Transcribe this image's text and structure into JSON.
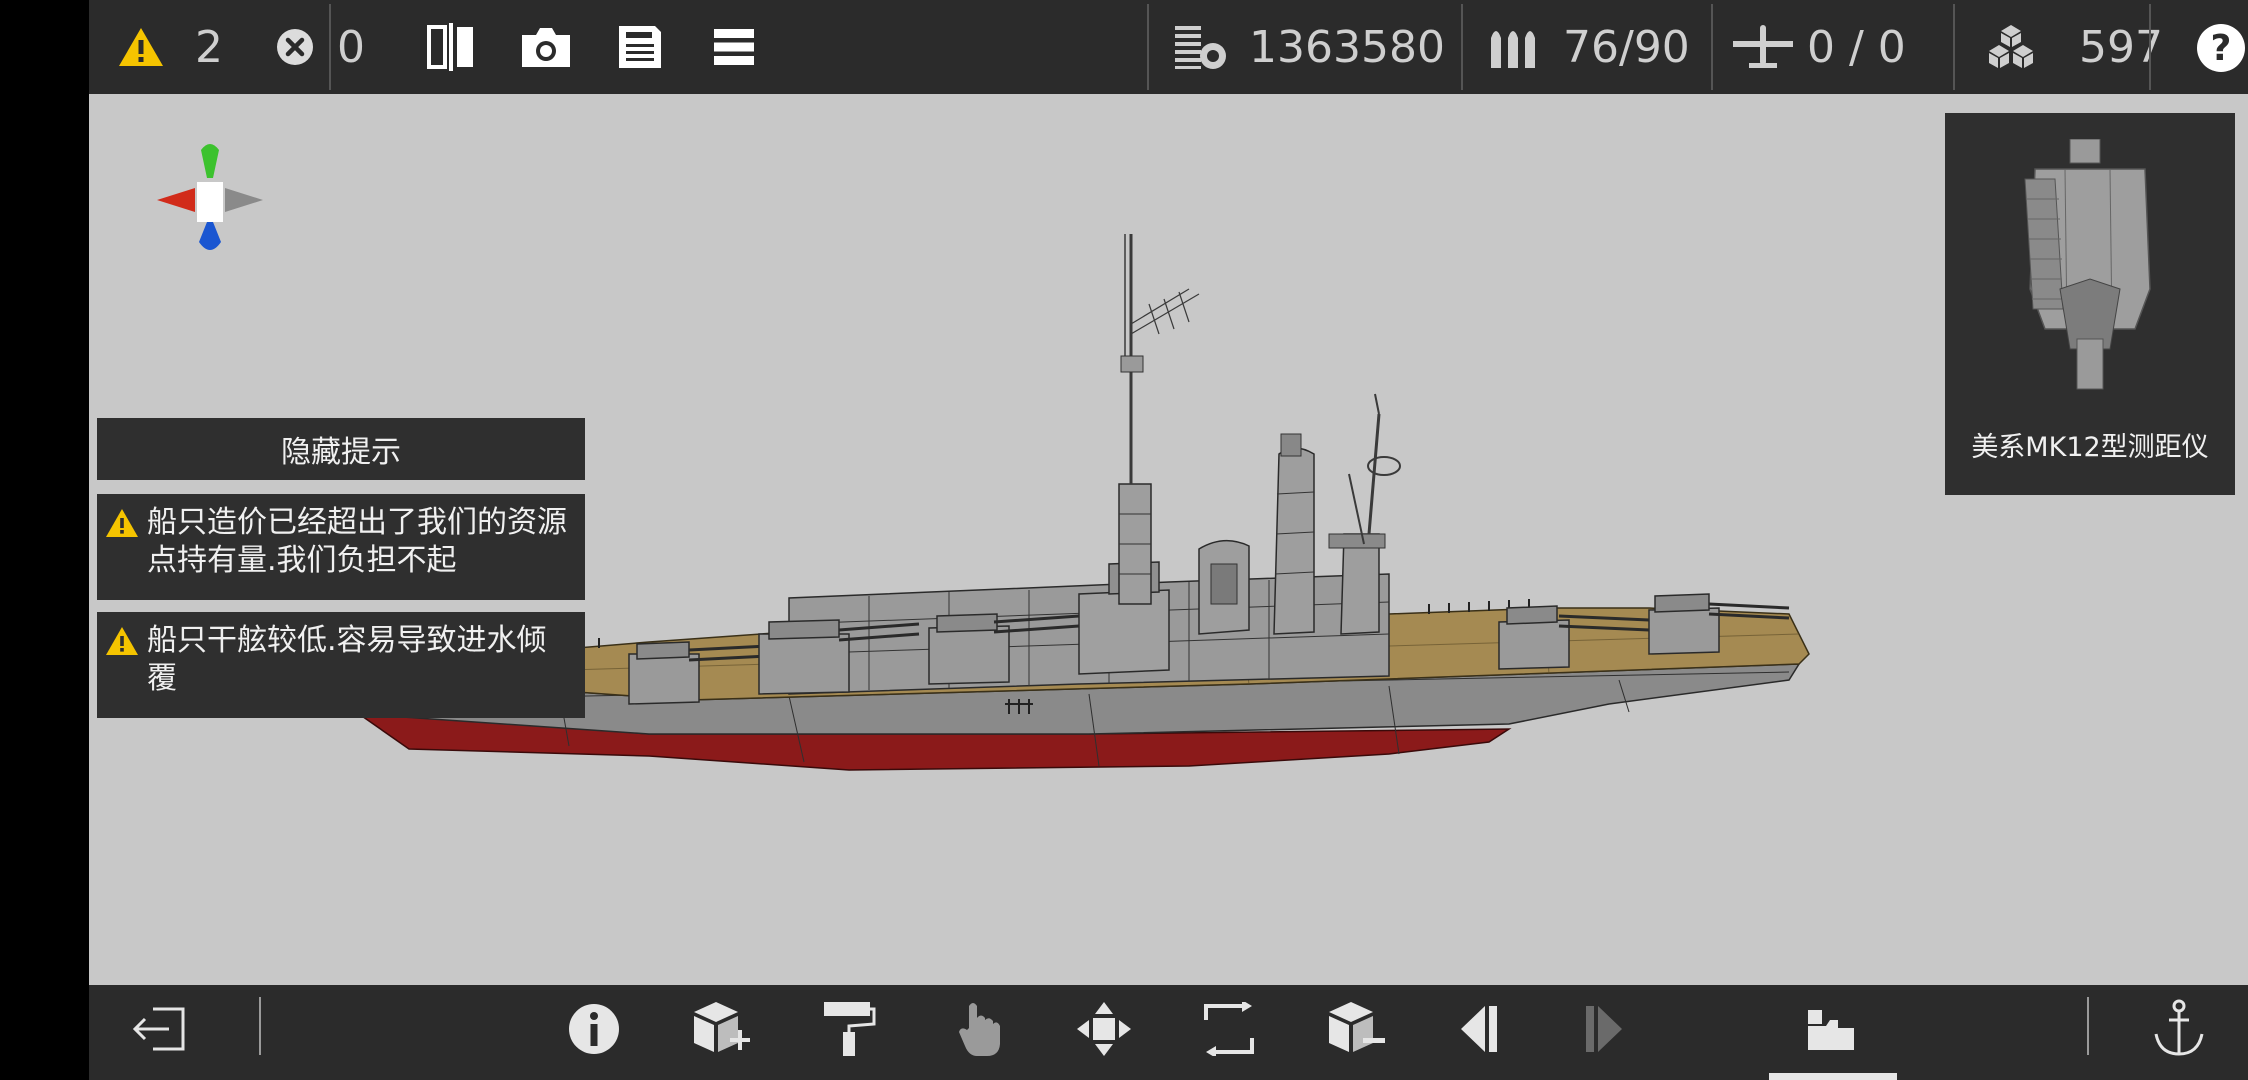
{
  "topbar": {
    "warnings": "2",
    "errors": "0",
    "cost": "1363580",
    "ammo": "76/90",
    "aircraft": "0 / 0",
    "resources": "597",
    "help": "?"
  },
  "tips": {
    "hide_label": "隐藏提示",
    "items": [
      {
        "text": "船只造价已经超出了我们的资源点持有量.我们负担不起"
      },
      {
        "text": "船只干舷较低.容易导致进水倾覆"
      }
    ]
  },
  "selected_part": {
    "name": "美系MK12型测距仪"
  },
  "colors": {
    "deck": "#a58a52",
    "hull": "#8a8a8a",
    "bottom": "#8b1a1a",
    "warning": "#f5c400"
  },
  "icons": {
    "top": [
      "warning-icon",
      "error-icon",
      "symmetry-icon",
      "camera-icon",
      "save-icon",
      "menu-icon",
      "cost-icon",
      "ammo-icon",
      "aircraft-icon",
      "resource-icon",
      "help-icon"
    ],
    "bottom": [
      "exit-icon",
      "info-icon",
      "add-block-icon",
      "paint-roller-icon",
      "hand-icon",
      "move-icon",
      "rotate-icon",
      "remove-block-icon",
      "prev-icon",
      "next-icon",
      "parts-icon",
      "anchor-icon"
    ]
  }
}
